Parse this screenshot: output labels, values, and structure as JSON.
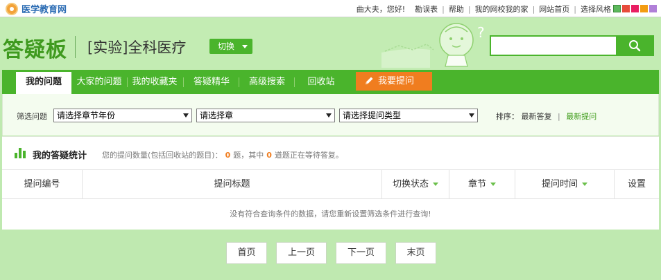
{
  "topbar": {
    "logo_text": "医学教育网",
    "greeting": "曲大夫，您好!",
    "links": [
      "勘误表",
      "帮助",
      "我的网校我的家",
      "网站首页",
      "选择风格"
    ],
    "style_swatches": [
      "#5cb85c",
      "#e74c3c",
      "#e91e63",
      "#f39c12",
      "#b07fd8"
    ]
  },
  "header": {
    "brand": "答疑板",
    "subject": "[实验]全科医疗",
    "switch_label": "切换",
    "search": {
      "value": "",
      "placeholder": "",
      "button_icon": "search-icon"
    }
  },
  "nav": {
    "tabs": [
      {
        "label": "我的问题",
        "active": true
      },
      {
        "label": "大家的问题",
        "active": false
      },
      {
        "label": "我的收藏夹",
        "active": false
      },
      {
        "label": "答疑精华",
        "active": false
      },
      {
        "label": "高级搜索",
        "active": false
      },
      {
        "label": "回收站",
        "active": false
      }
    ],
    "ask_button": "我要提问"
  },
  "filter": {
    "label": "筛选问题",
    "selects": [
      "请选择章节年份",
      "请选择章",
      "请选择提问类型"
    ],
    "sort_label": "排序：",
    "sort_options": [
      {
        "label": "最新答复",
        "active": false
      },
      {
        "label": "最新提问",
        "active": true
      }
    ]
  },
  "stats": {
    "title": "我的答疑统计",
    "desc_prefix": "您的提问数量(包括回收站的题目)：",
    "question_count": "0",
    "desc_mid": "题，其中",
    "waiting_count": "0",
    "desc_suffix": "道题正在等待答复。"
  },
  "table": {
    "columns": [
      {
        "label": "提问编号",
        "sortable": false
      },
      {
        "label": "提问标题",
        "sortable": false
      },
      {
        "label": "切换状态",
        "sortable": true
      },
      {
        "label": "章节",
        "sortable": true
      },
      {
        "label": "提问时间",
        "sortable": true
      },
      {
        "label": "设置",
        "sortable": false
      }
    ],
    "empty_message": "没有符合查询条件的数据，请您重新设置筛选条件进行查询!"
  },
  "pagination": {
    "first": "首页",
    "prev": "上一页",
    "next": "下一页",
    "last": "末页"
  },
  "colors": {
    "accent": "#4ab42c",
    "orange": "#f07d1f",
    "page_bg": "#bfe9b0"
  }
}
